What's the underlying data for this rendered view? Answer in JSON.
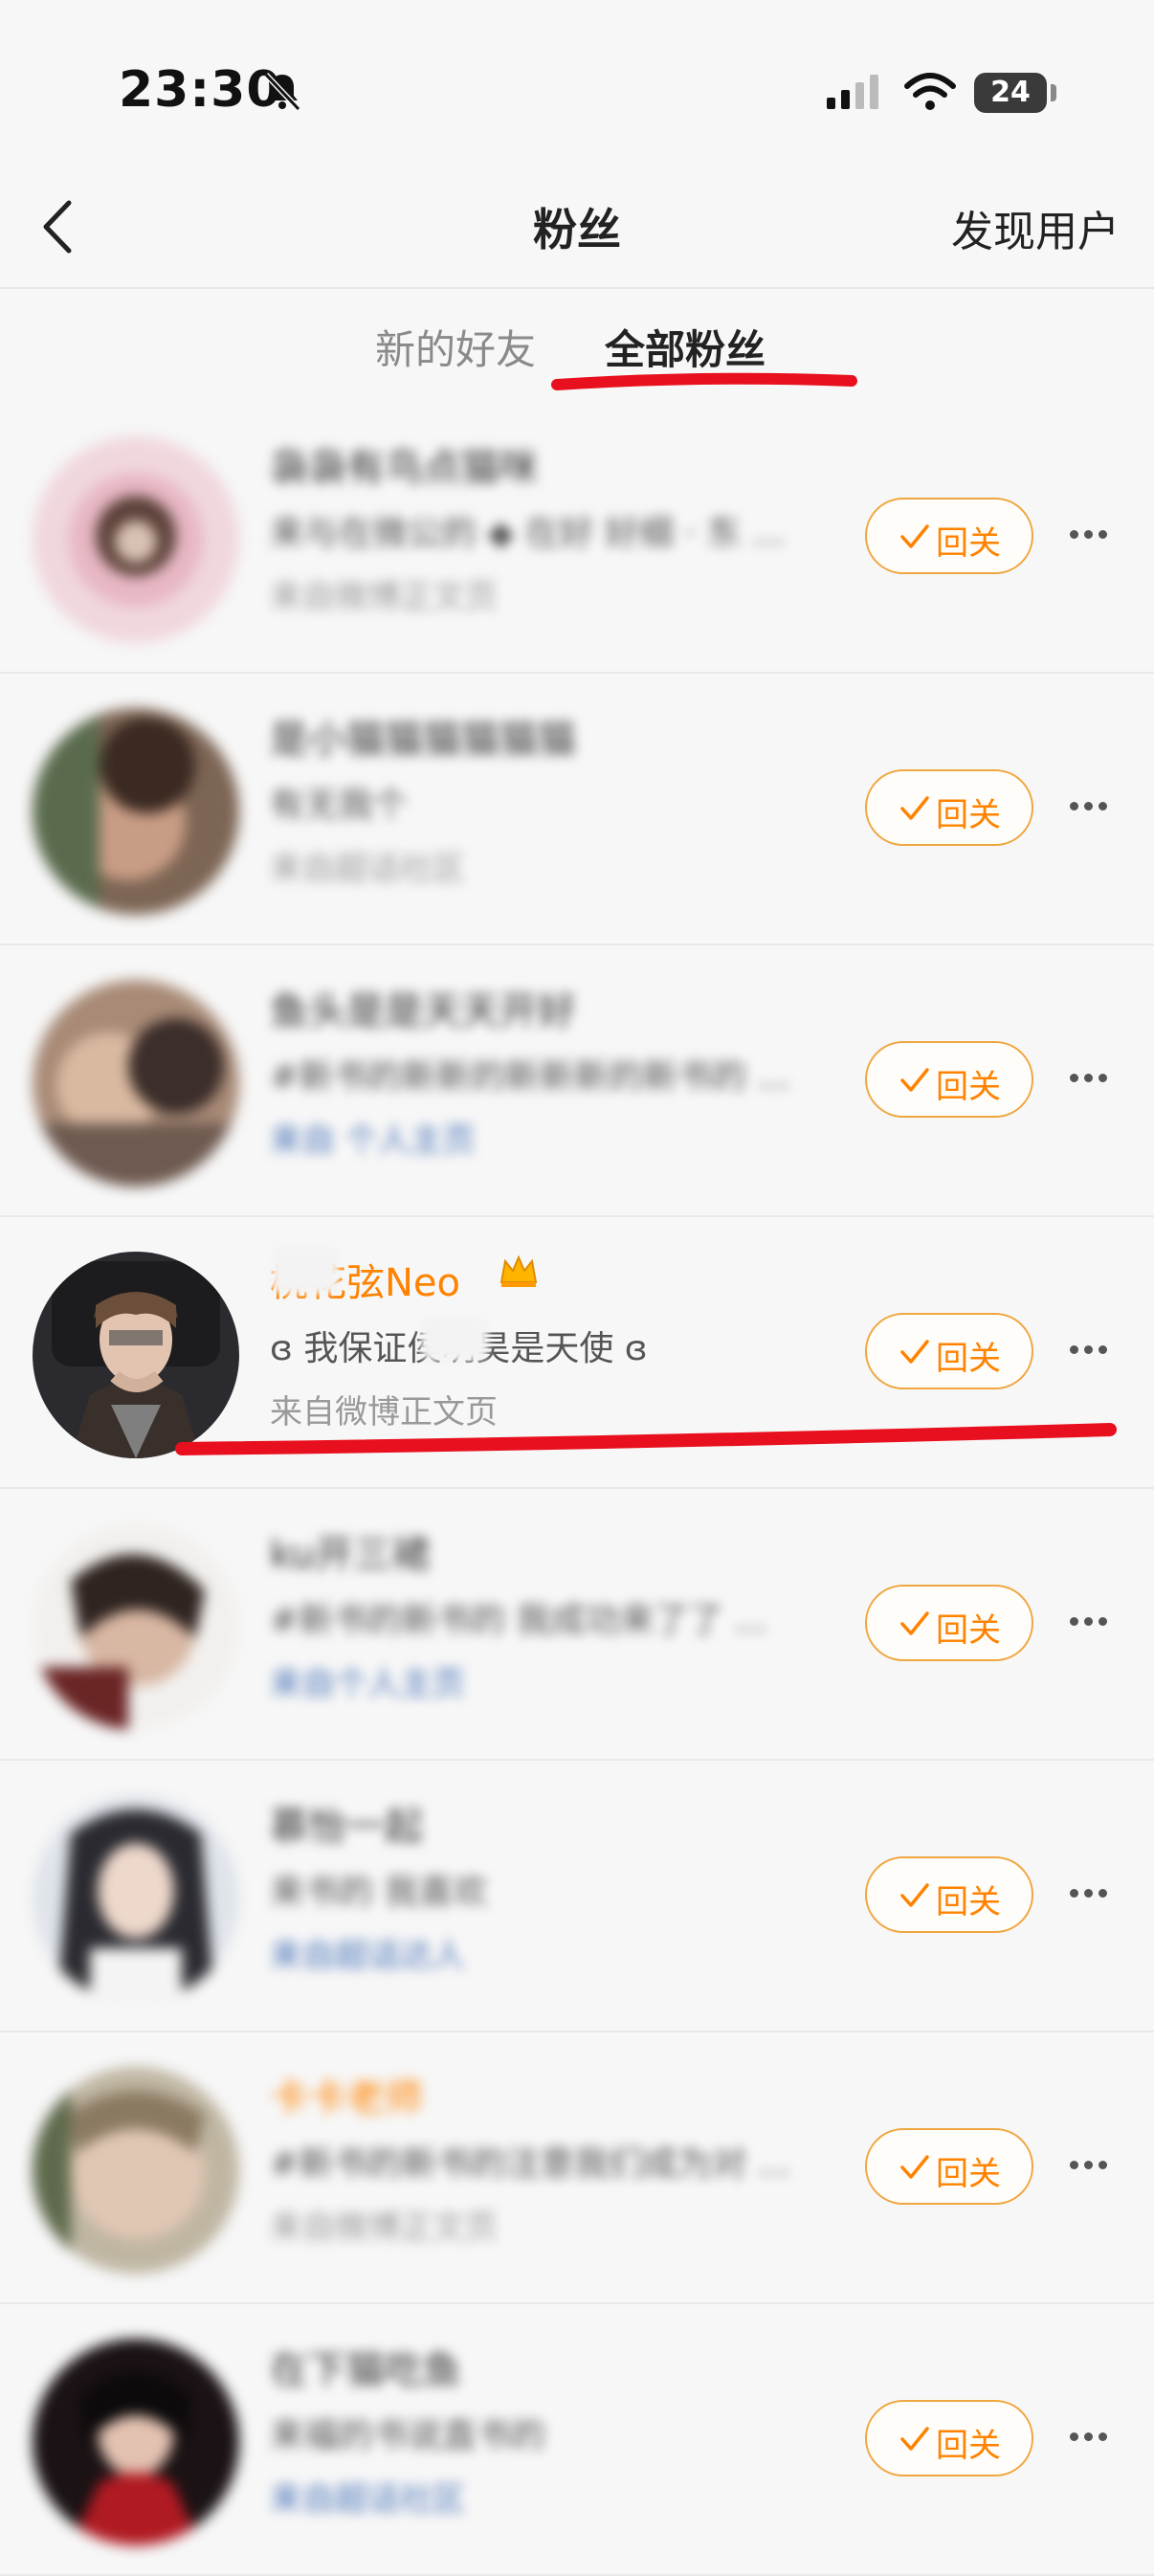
{
  "status_bar": {
    "time": "23:30",
    "battery": "24",
    "icons": [
      "bell-slash-icon",
      "signal-icon",
      "wifi-icon",
      "battery-icon"
    ]
  },
  "nav": {
    "back_icon": "chevron-left-icon",
    "title": "粉丝",
    "discover_label": "发现用户"
  },
  "tabs": [
    {
      "label": "新的好友",
      "active": false
    },
    {
      "label": "全部粉丝",
      "active": true
    }
  ],
  "colors": {
    "accent": "#ff8200",
    "button_border": "#f0a640",
    "annotation": "#e8101e",
    "background": "#f7f7f7"
  },
  "follow_back_label": "回关",
  "fans": [
    {
      "name": "袅袅有鸟点猫咪",
      "desc": "来与在微公的 ◆ 在好 好细 · 东 ...",
      "source": "来自微博正文页",
      "blurred": true,
      "name_color": "normal"
    },
    {
      "name": "是小猫猫猫猫猫猫",
      "desc": "有无我个",
      "source": "来自超话社区",
      "blurred": true,
      "name_color": "normal"
    },
    {
      "name": "鱼头是是天天开好",
      "desc": "#新书的新新的新新新的新书的 ...",
      "source": "来自 个人主页",
      "blurred": true,
      "name_color": "normal"
    },
    {
      "name": "桃花弦Neo",
      "desc": "ɞ 我保证侯明昊是天使 ɞ",
      "source": "来自微博正文页",
      "blurred": false,
      "name_color": "orange"
    },
    {
      "name": "ku开三裙",
      "desc": "#新书的新书的 我成功来了了 ...",
      "source": "来自个人主页",
      "blurred": true,
      "name_color": "normal"
    },
    {
      "name": "慕怡一起",
      "desc": "来书的 我喜欢",
      "source": "来自超话达人",
      "blurred": true,
      "name_color": "normal"
    },
    {
      "name": "卡卡老师",
      "desc": "#新书的新书的注意我们成为对 ...",
      "source": "来自微博正文页",
      "blurred": true,
      "name_color": "orange"
    },
    {
      "name": "在下猫吃鱼",
      "desc": "来福的书说直书的",
      "source": "来自超话社区",
      "blurred": true,
      "name_color": "normal"
    }
  ]
}
